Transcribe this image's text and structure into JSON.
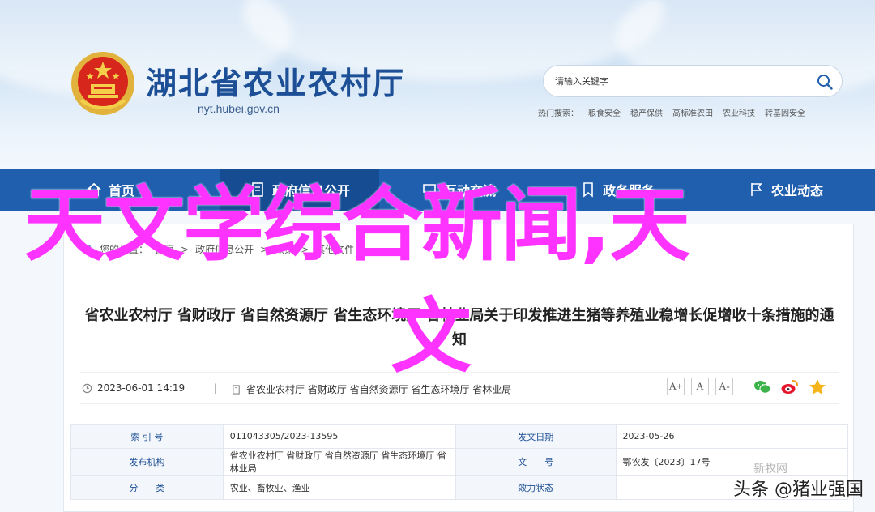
{
  "header": {
    "site_title": "湖北省农业农村厅",
    "domain": "nyt.hubei.gov.cn",
    "search_placeholder": "请输入关键字",
    "hot_search_label": "热门搜索：",
    "hot_search_items": [
      "粮食安全",
      "稳产保供",
      "高标准农田",
      "农业科技",
      "转基因安全"
    ]
  },
  "nav": {
    "items": [
      {
        "label": "首页",
        "icon": "home-icon"
      },
      {
        "label": "政府信息公开",
        "icon": "document-icon"
      },
      {
        "label": "互动交流",
        "icon": "chat-icon"
      },
      {
        "label": "政务服务",
        "icon": "bookmark-icon"
      },
      {
        "label": "农业动态",
        "icon": "flag-icon"
      }
    ]
  },
  "breadcrumb": {
    "label": "您的位置：",
    "items": [
      "首页",
      "政府信息公开",
      "政策",
      "其他文件"
    ]
  },
  "article": {
    "title": "省农业农村厅 省财政厅 省自然资源厅 省生态环境厅 省林业局关于印发推进生猪等养殖业稳增长促增收十条措施的通知",
    "date": "2023-06-01 14:19",
    "separator": "|",
    "orgs": "省农业农村厅 省财政厅 省自然资源厅 省生态环境厅 省林业局",
    "font_buttons": [
      "A+",
      "A",
      "A-"
    ],
    "share_icons": [
      "wechat-icon",
      "weibo-icon",
      "favorite-star-icon"
    ]
  },
  "info_table": {
    "rows": [
      {
        "label1": "索 引 号",
        "value1": "011043305/2023-13595",
        "label2": "发文日期",
        "value2": "2023-05-26"
      },
      {
        "label1": "发布机构",
        "value1": "省农业农村厅 省财政厅 省自然资源厅 省生态环境厅 省林业局",
        "label2": "文　　号",
        "value2": "鄂农发〔2023〕17号"
      },
      {
        "label1": "分　　类",
        "value1": "农业、畜牧业、渔业",
        "label2": "效力状态",
        "value2": ""
      }
    ]
  },
  "overlay": {
    "line1": "天文学综合新闻,天",
    "line2": "文",
    "watermark": "头条 @猪业强国",
    "faint_mark": "新牧网"
  },
  "colors": {
    "nav_bg": "#1f5fae",
    "overlay_text": "#ff33ff",
    "title_blue": "#1d4f96"
  }
}
